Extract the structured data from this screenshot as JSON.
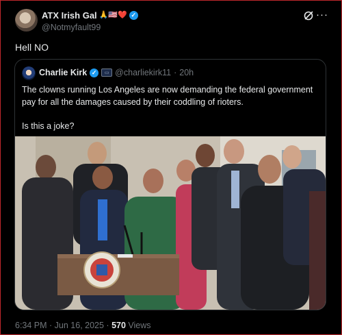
{
  "author": {
    "display_name": "ATX Irish Gal",
    "emoji": "🙏🇺🇸❤️",
    "handle": "@Notmyfault99"
  },
  "post": {
    "text": "Hell NO"
  },
  "quoted": {
    "display_name": "Charlie Kirk",
    "handle": "@charliekirk11",
    "separator": "·",
    "time": "20h",
    "line1": "The clowns running Los Angeles are now demanding the federal government pay for all the damages caused by their coddling of rioters.",
    "line2": "Is this a joke?"
  },
  "meta": {
    "timestamp": "6:34 PM · Jun 16, 2025 ·",
    "views_count": "570",
    "views_label": "Views"
  },
  "icons": {
    "verified": "verified-badge-icon",
    "grok": "grok-icon",
    "more": "more-options-icon"
  },
  "colors": {
    "accent": "#1d9bf0",
    "background": "#000000",
    "secondary_text": "#71767b"
  }
}
